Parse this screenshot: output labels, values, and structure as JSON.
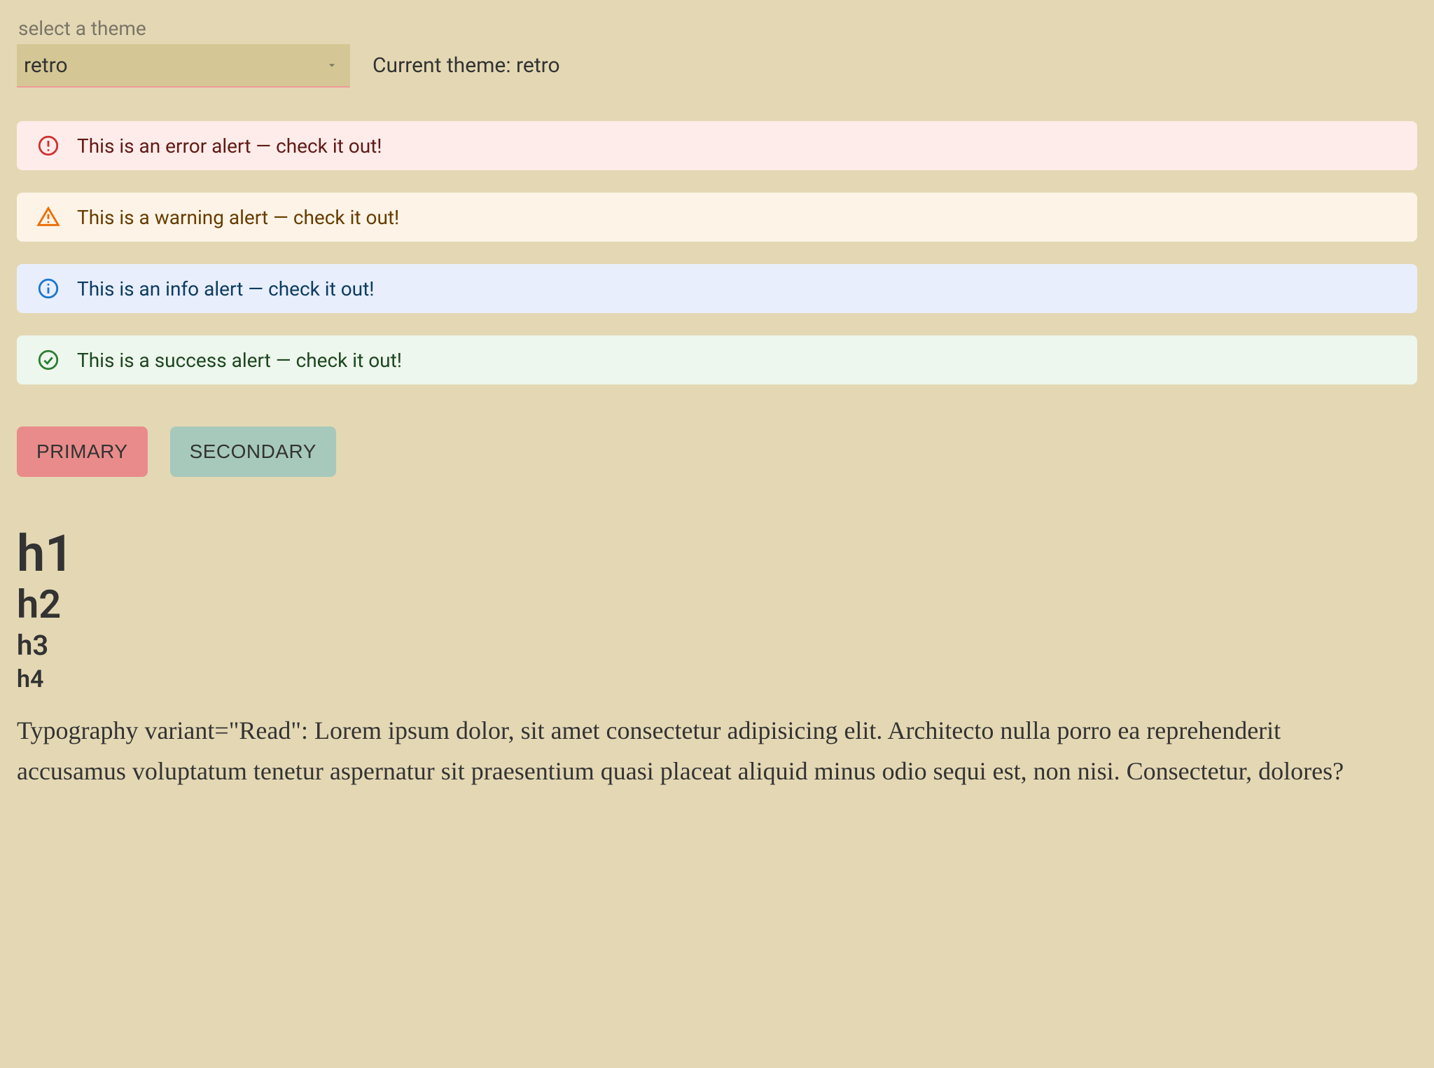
{
  "theme": {
    "select_label": "select a theme",
    "selected_value": "retro",
    "current_label": "Current theme: retro"
  },
  "alerts": {
    "error": "This is an error alert — check it out!",
    "warning": "This is a warning alert — check it out!",
    "info": "This is an info alert — check it out!",
    "success": "This is a success alert — check it out!"
  },
  "buttons": {
    "primary_label": "PRIMARY",
    "secondary_label": "SECONDARY"
  },
  "typography": {
    "h1": "h1",
    "h2": "h2",
    "h3": "h3",
    "h4": "h4",
    "read": "Typography variant=\"Read\": Lorem ipsum dolor, sit amet consectetur adipisicing elit. Architecto nulla porro ea reprehenderit accusamus voluptatum tenetur aspernatur sit praesentium quasi placeat aliquid minus odio sequi est, non nisi. Consectetur, dolores?"
  },
  "colors": {
    "background": "#e4d8b4",
    "primary": "#e98b8b",
    "secondary": "#a6c9bb"
  }
}
